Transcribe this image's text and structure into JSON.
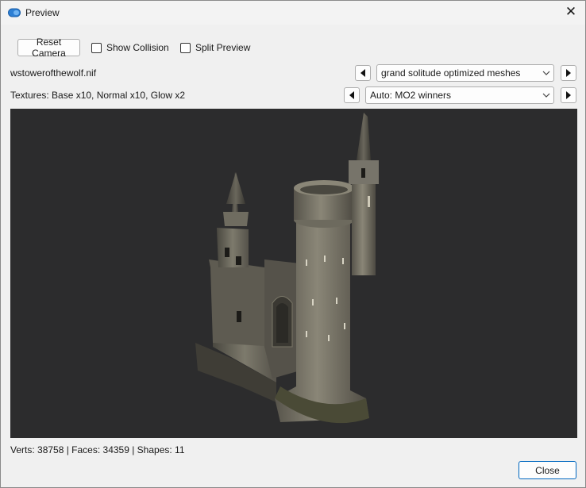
{
  "window": {
    "title": "Preview",
    "close_glyph": "✕"
  },
  "toolbar": {
    "reset_camera": "Reset Camera",
    "show_collision": {
      "label": "Show Collision",
      "checked": false
    },
    "split_preview": {
      "label": "Split Preview",
      "checked": false
    }
  },
  "mesh": {
    "filename": "wstowerofthewolf.nif",
    "source_selected": "grand solitude optimized meshes"
  },
  "textures": {
    "summary": "Textures: Base x10, Normal x10, Glow x2",
    "source_selected": "Auto: MO2 winners"
  },
  "stats": "Verts: 38758 | Faces: 34359 | Shapes: 11",
  "footer": {
    "close_label": "Close"
  },
  "colors": {
    "viewport_bg": "#2c2c2d",
    "accent": "#0067c0",
    "model": "#6e6b5f"
  }
}
